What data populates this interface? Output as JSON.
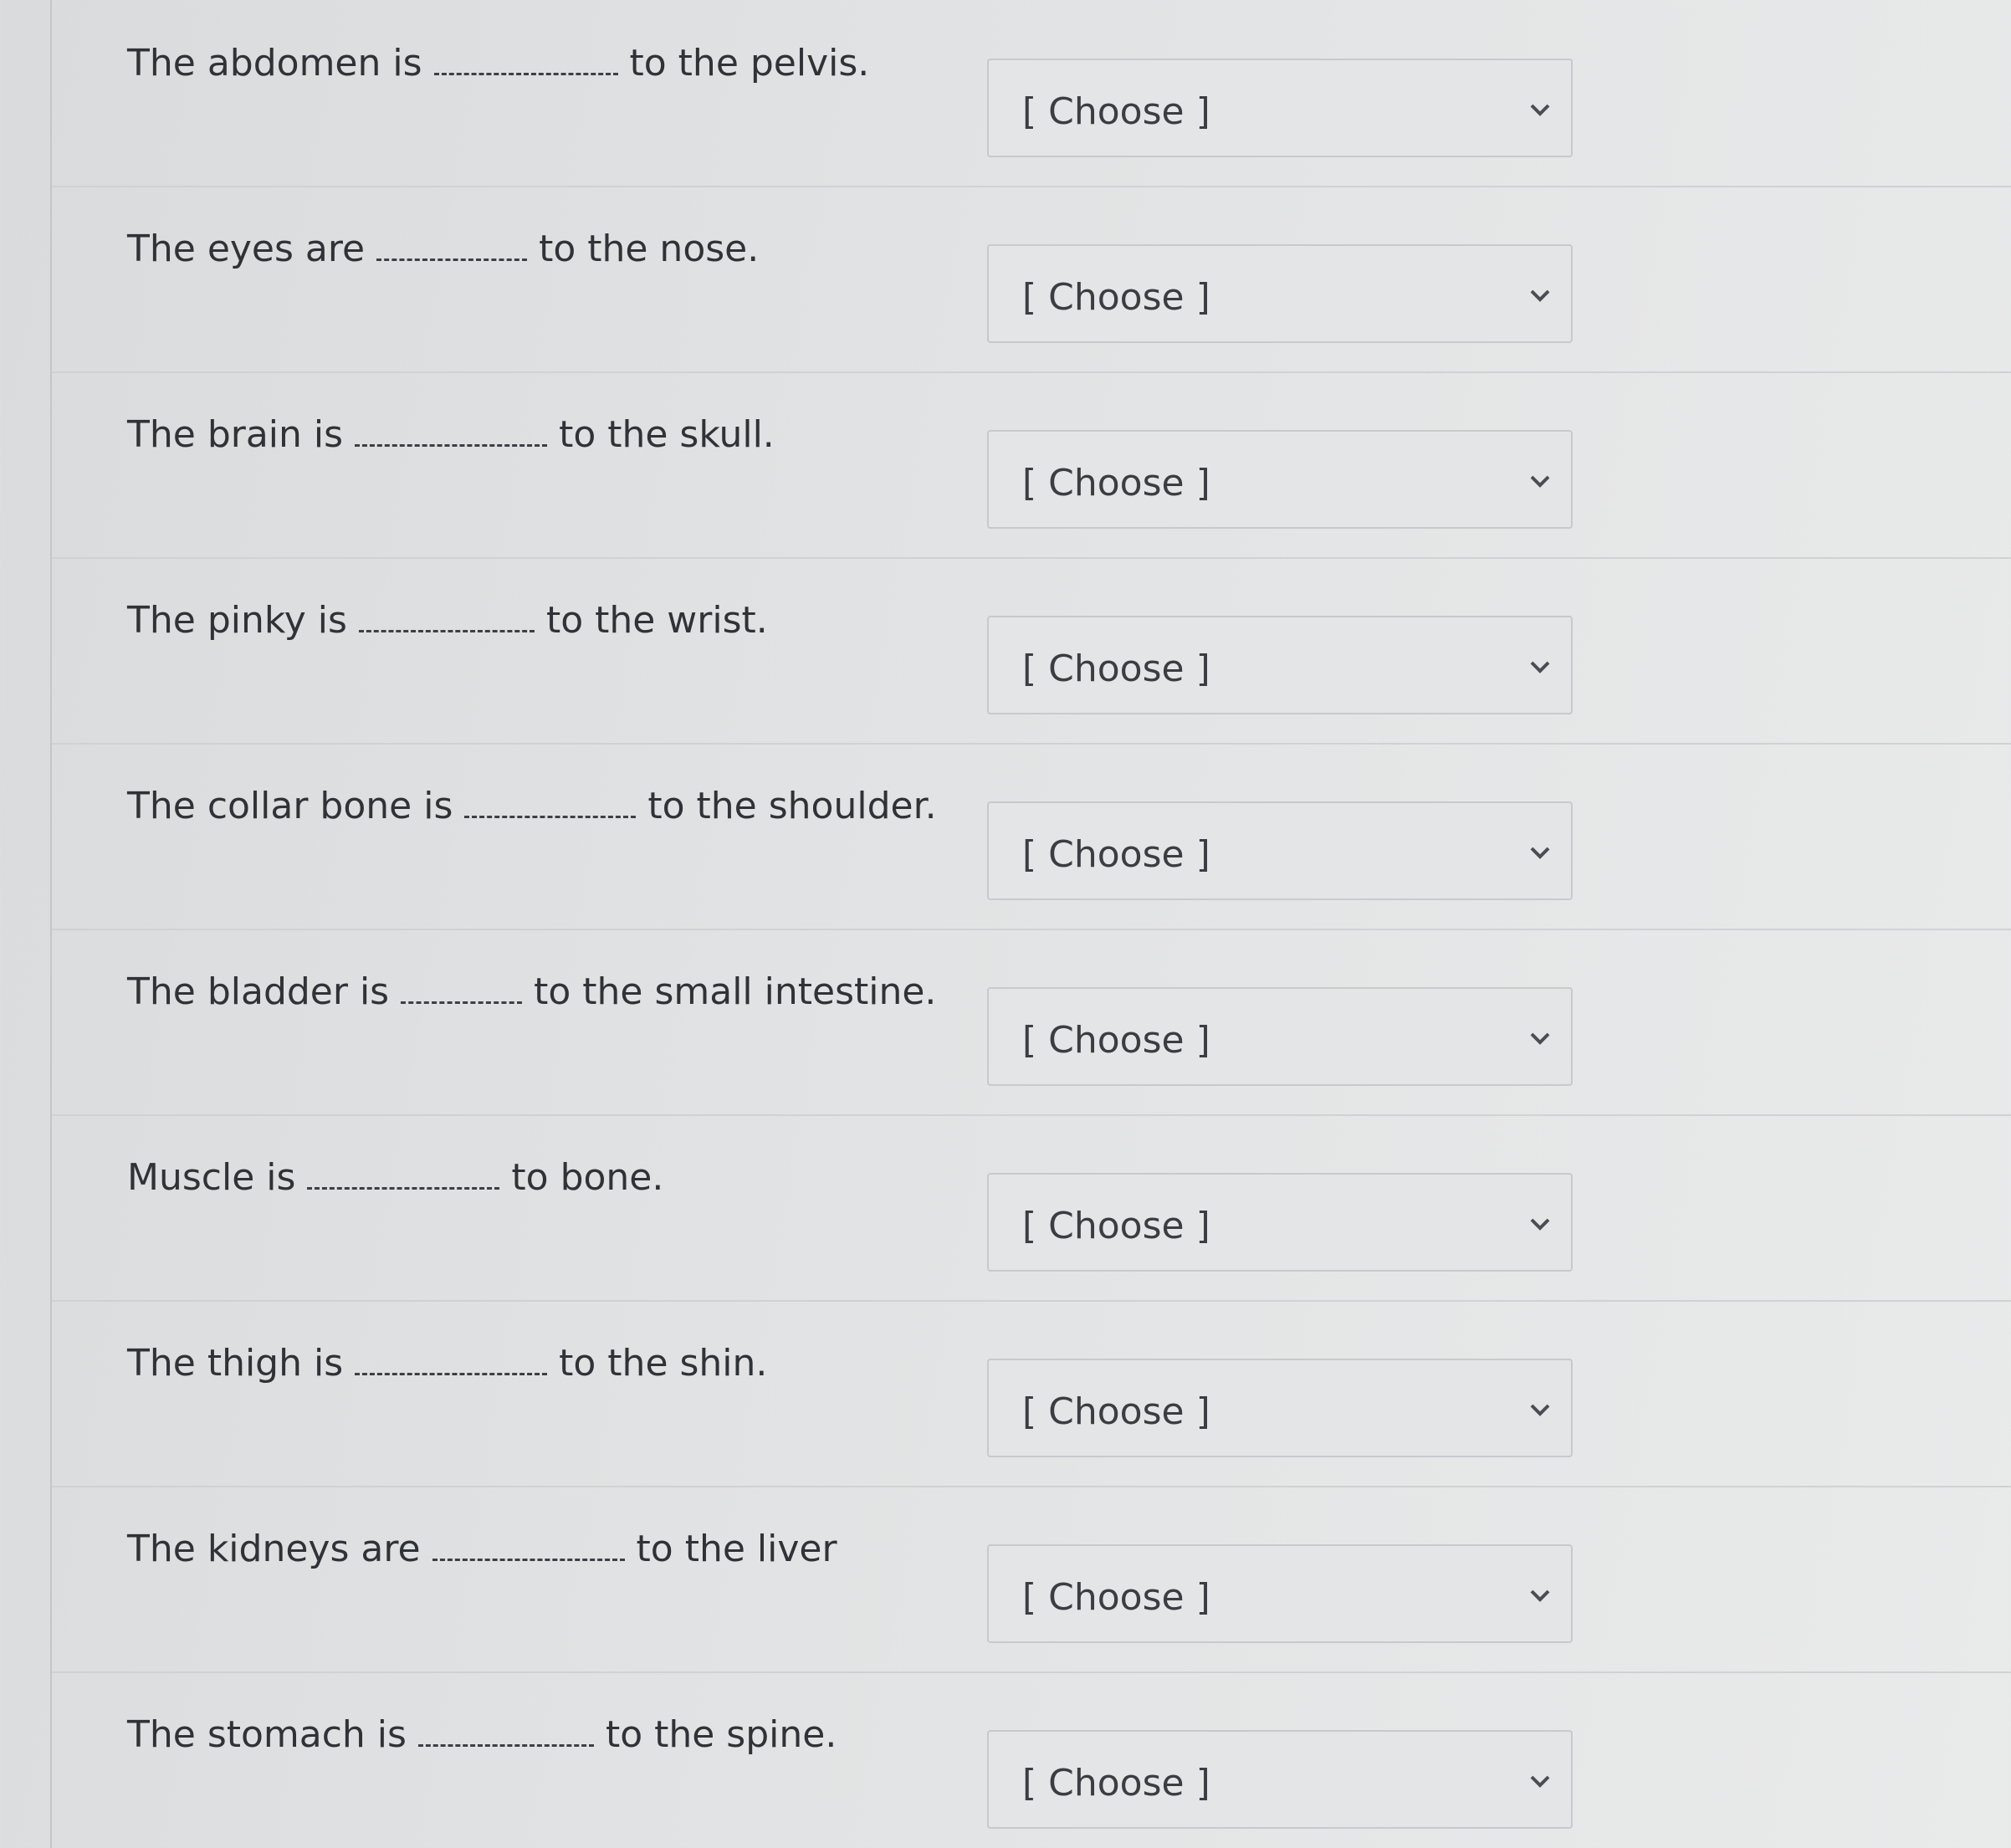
{
  "questions": [
    {
      "before": "The abdomen is",
      "after": "to the pelvis.",
      "selected": "[ Choose ]"
    },
    {
      "before": "The eyes are",
      "after": "to the nose.",
      "selected": "[ Choose ]"
    },
    {
      "before": "The brain is",
      "after": "to the skull.",
      "selected": "[ Choose ]"
    },
    {
      "before": "The pinky is",
      "after": "to the wrist.",
      "selected": "[ Choose ]"
    },
    {
      "before": "The collar bone is",
      "after": "to the shoulder.",
      "selected": "[ Choose ]"
    },
    {
      "before": "The bladder is",
      "after": "to the small intestine.",
      "selected": "[ Choose ]"
    },
    {
      "before": "Muscle is",
      "after": "to bone.",
      "selected": "[ Choose ]"
    },
    {
      "before": "The thigh is",
      "after": "to the shin.",
      "selected": "[ Choose ]"
    },
    {
      "before": "The kidneys are",
      "after": "to the liver",
      "selected": "[ Choose ]"
    },
    {
      "before": "The stomach is",
      "after": "to the spine.",
      "selected": "[ Choose ]"
    }
  ],
  "icons": {
    "dropdown": "chevron-down-icon"
  }
}
